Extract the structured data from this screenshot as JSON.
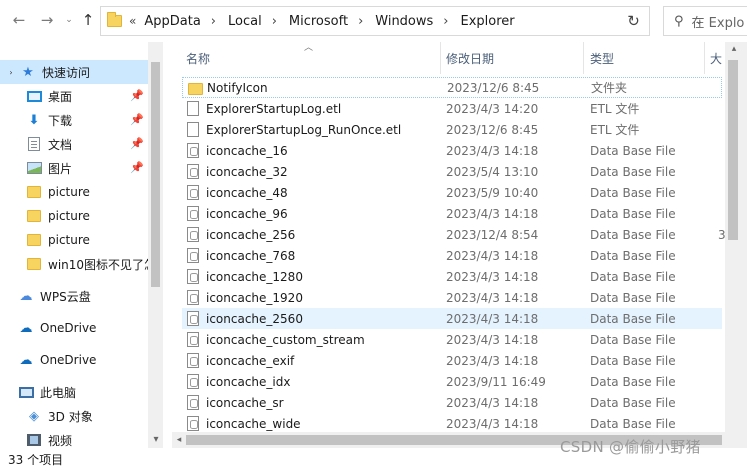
{
  "nav": {
    "path_lead": "«",
    "breadcrumbs": [
      "AppData",
      "Local",
      "Microsoft",
      "Windows",
      "Explorer"
    ],
    "search_placeholder": "在 Explo"
  },
  "sidebar": {
    "items": [
      {
        "label": "快速访问",
        "icon": "star-icon",
        "selected": true,
        "pinned": false
      },
      {
        "label": "桌面",
        "icon": "desktop-icon",
        "selected": false,
        "pinned": true
      },
      {
        "label": "下载",
        "icon": "download-icon",
        "selected": false,
        "pinned": true
      },
      {
        "label": "文档",
        "icon": "document-icon",
        "selected": false,
        "pinned": true
      },
      {
        "label": "图片",
        "icon": "pictures-icon",
        "selected": false,
        "pinned": true
      },
      {
        "label": "picture",
        "icon": "folder-icon",
        "selected": false,
        "pinned": false
      },
      {
        "label": "picture",
        "icon": "folder-icon",
        "selected": false,
        "pinned": false
      },
      {
        "label": "picture",
        "icon": "folder-icon",
        "selected": false,
        "pinned": false
      },
      {
        "label": "win10图标不见了怎",
        "icon": "folder-icon",
        "selected": false,
        "pinned": false
      },
      {
        "label": "WPS云盘",
        "icon": "wps-cloud-icon",
        "selected": false,
        "pinned": false
      },
      {
        "label": "OneDrive",
        "icon": "onedrive-icon",
        "selected": false,
        "pinned": false
      },
      {
        "label": "OneDrive",
        "icon": "onedrive-icon",
        "selected": false,
        "pinned": false
      },
      {
        "label": "此电脑",
        "icon": "computer-icon",
        "selected": false,
        "pinned": false
      },
      {
        "label": "3D 对象",
        "icon": "3d-objects-icon",
        "selected": false,
        "pinned": false
      },
      {
        "label": "视频",
        "icon": "videos-icon",
        "selected": false,
        "pinned": false
      }
    ]
  },
  "columns": {
    "name": "名称",
    "date": "修改日期",
    "type": "类型",
    "size": "大"
  },
  "files": [
    {
      "name": "NotifyIcon",
      "date": "2023/12/6 8:45",
      "type": "文件夹",
      "size": "",
      "kind": "folder"
    },
    {
      "name": "ExplorerStartupLog.etl",
      "date": "2023/4/3 14:20",
      "type": "ETL 文件",
      "size": "",
      "kind": "doc"
    },
    {
      "name": "ExplorerStartupLog_RunOnce.etl",
      "date": "2023/12/6 8:45",
      "type": "ETL 文件",
      "size": "",
      "kind": "doc"
    },
    {
      "name": "iconcache_16",
      "date": "2023/4/3 14:18",
      "type": "Data Base File",
      "size": "",
      "kind": "db"
    },
    {
      "name": "iconcache_32",
      "date": "2023/5/4 13:10",
      "type": "Data Base File",
      "size": "",
      "kind": "db"
    },
    {
      "name": "iconcache_48",
      "date": "2023/5/9 10:40",
      "type": "Data Base File",
      "size": "",
      "kind": "db"
    },
    {
      "name": "iconcache_96",
      "date": "2023/4/3 14:18",
      "type": "Data Base File",
      "size": "",
      "kind": "db"
    },
    {
      "name": "iconcache_256",
      "date": "2023/12/4 8:54",
      "type": "Data Base File",
      "size": "3",
      "kind": "db"
    },
    {
      "name": "iconcache_768",
      "date": "2023/4/3 14:18",
      "type": "Data Base File",
      "size": "",
      "kind": "db"
    },
    {
      "name": "iconcache_1280",
      "date": "2023/4/3 14:18",
      "type": "Data Base File",
      "size": "",
      "kind": "db"
    },
    {
      "name": "iconcache_1920",
      "date": "2023/4/3 14:18",
      "type": "Data Base File",
      "size": "",
      "kind": "db"
    },
    {
      "name": "iconcache_2560",
      "date": "2023/4/3 14:18",
      "type": "Data Base File",
      "size": "",
      "kind": "db"
    },
    {
      "name": "iconcache_custom_stream",
      "date": "2023/4/3 14:18",
      "type": "Data Base File",
      "size": "",
      "kind": "db"
    },
    {
      "name": "iconcache_exif",
      "date": "2023/4/3 14:18",
      "type": "Data Base File",
      "size": "",
      "kind": "db"
    },
    {
      "name": "iconcache_idx",
      "date": "2023/9/11 16:49",
      "type": "Data Base File",
      "size": "",
      "kind": "db"
    },
    {
      "name": "iconcache_sr",
      "date": "2023/4/3 14:18",
      "type": "Data Base File",
      "size": "",
      "kind": "db"
    },
    {
      "name": "iconcache_wide",
      "date": "2023/4/3 14:18",
      "type": "Data Base File",
      "size": "",
      "kind": "db"
    }
  ],
  "focused_row": 0,
  "hovered_row": 11,
  "status": {
    "item_count": "33 个项目"
  },
  "watermark": "CSDN @偷偷小野猪"
}
